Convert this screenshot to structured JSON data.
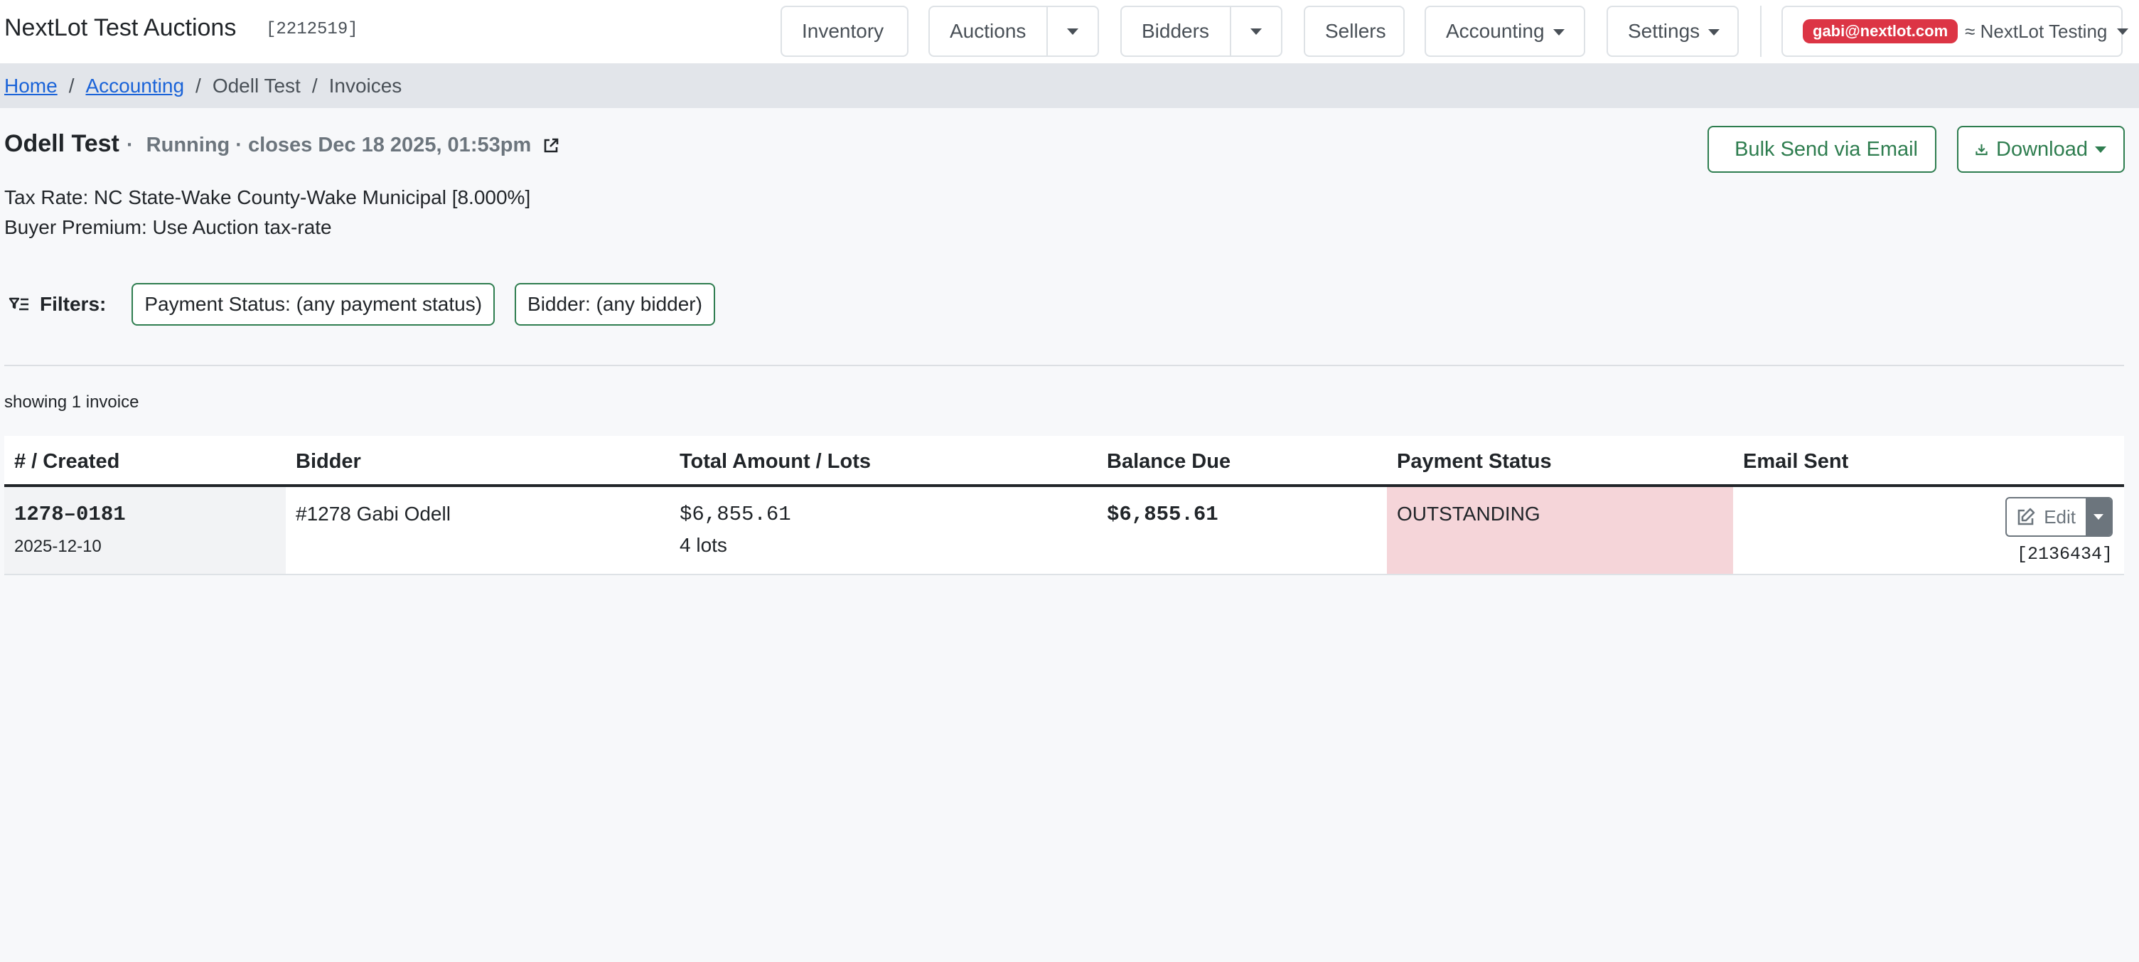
{
  "nav": {
    "brand": "NextLot Test Auctions",
    "brand_id": "[2212519]",
    "inventory": "Inventory",
    "auctions": "Auctions",
    "bidders": "Bidders",
    "sellers": "Sellers",
    "accounting": "Accounting",
    "settings": "Settings",
    "user_email": "gabi@nextlot.com",
    "account": "≈ NextLot Testing"
  },
  "breadcrumb": {
    "home": "Home",
    "accounting": "Accounting",
    "auction": "Odell Test",
    "current": "Invoices",
    "separator": "/"
  },
  "auction": {
    "title": "Odell Test",
    "dot": "·",
    "status": "Running · closes Dec 18 2025, 01:53pm",
    "tax_rate": "Tax Rate: NC State-Wake County-Wake Municipal [8.000%]",
    "buyer_premium": "Buyer Premium: Use Auction tax-rate"
  },
  "actions": {
    "bulk_send": "Bulk Send via Email",
    "download": "Download"
  },
  "filters": {
    "label": "Filters:",
    "payment_status": "Payment Status: (any payment status)",
    "bidder": "Bidder: (any bidder)"
  },
  "summary": {
    "showing": "showing 1 invoice"
  },
  "table": {
    "headers": [
      "# / Created",
      "Bidder",
      "Total Amount / Lots",
      "Balance Due",
      "Payment Status",
      "Email Sent"
    ],
    "rows": [
      {
        "number": "1278–0181",
        "created": "2025-12-10",
        "bidder": "#1278 Gabi Odell",
        "total": "$6,855.61",
        "lots": "4 lots",
        "balance": "$6,855.61",
        "status": "OUTSTANDING",
        "edit_label": "Edit",
        "invoice_id": "[2136434]"
      }
    ]
  },
  "colors": {
    "accent_green": "#2e7d4f",
    "link_blue": "#1a63d8",
    "badge_red": "#dc3545",
    "outstanding_bg": "#f5d5d9"
  }
}
